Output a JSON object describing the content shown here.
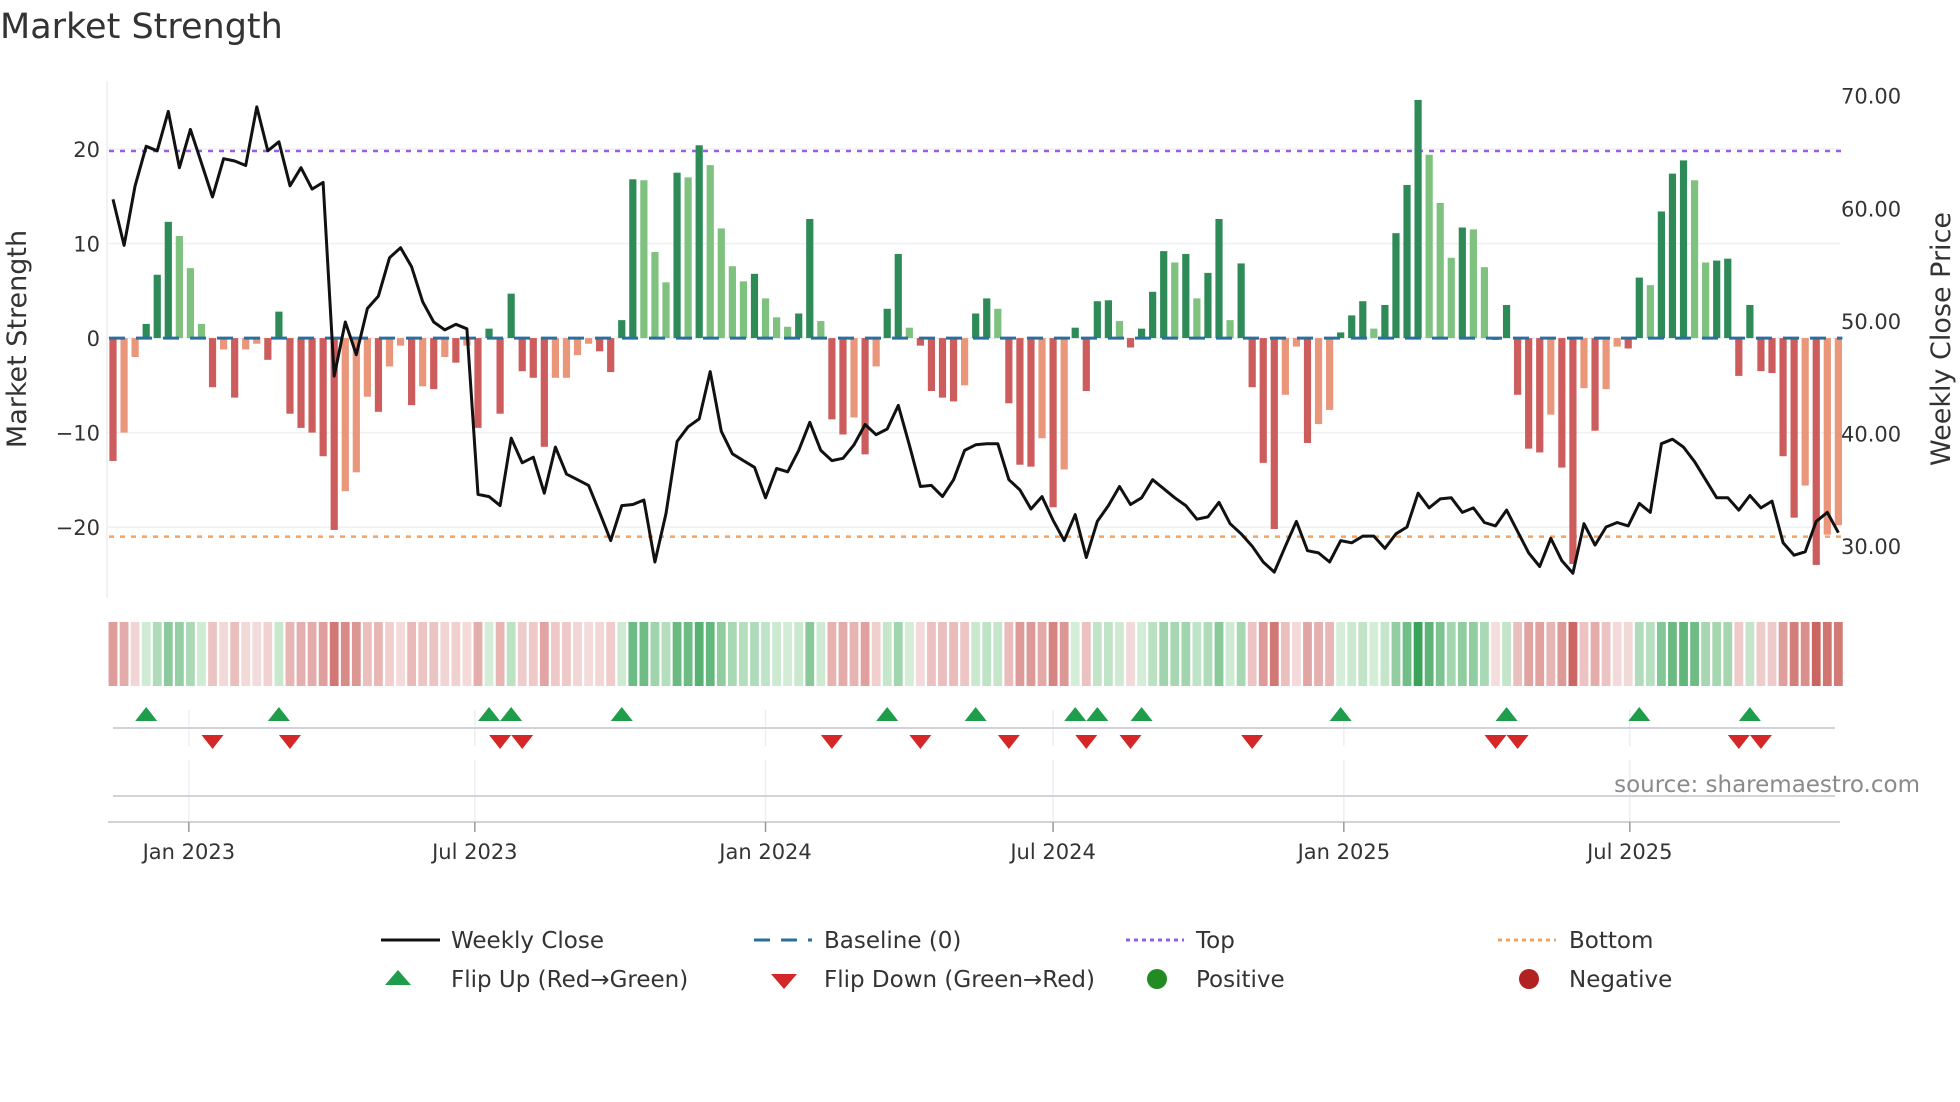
{
  "title": "Market Strength",
  "source": "source: sharemaestro.com",
  "legend": {
    "weekly_close": "Weekly Close",
    "baseline": "Baseline (0)",
    "top": "Top",
    "bottom": "Bottom",
    "flip_up": "Flip Up (Red→Green)",
    "flip_down": "Flip Down (Green→Red)",
    "positive": "Positive",
    "negative": "Negative"
  },
  "colors": {
    "strong_pos": "#2e8b57",
    "weak_pos": "#7fc17f",
    "strong_neg": "#cd5c5c",
    "weak_neg": "#e9967a",
    "close": "#111111",
    "baseline": "#2a6f9e",
    "top": "#9b5de5",
    "bottom": "#f4a460",
    "flip_up": "#1e9e4a",
    "flip_down": "#d62728",
    "positive": "#228b22",
    "negative": "#b22222"
  },
  "chart_data": {
    "type": "bar+line",
    "title": "Market Strength",
    "ylabel": "Market Strength",
    "ylabel_right": "Weekly Close Price",
    "x_start": "2022-11-14",
    "x_step_days": 7,
    "ylim": [
      -27.5,
      27.2
    ],
    "ylim_right": [
      25.4,
      71.3
    ],
    "yticks": [
      {
        "v": 20,
        "label": "20"
      },
      {
        "v": 10,
        "label": "10"
      },
      {
        "v": 0,
        "label": "0"
      },
      {
        "v": -10,
        "label": "−10"
      },
      {
        "v": -20,
        "label": "−20"
      }
    ],
    "yticks_right": [
      {
        "v": 70,
        "label": "70.00"
      },
      {
        "v": 60,
        "label": "60.00"
      },
      {
        "v": 50,
        "label": "50.00"
      },
      {
        "v": 40,
        "label": "40.00"
      },
      {
        "v": 30,
        "label": "30.00"
      }
    ],
    "xticks": [
      {
        "date": "2023-01-01",
        "label": "Jan 2023"
      },
      {
        "date": "2023-07-01",
        "label": "Jul 2023"
      },
      {
        "date": "2024-01-01",
        "label": "Jan 2024"
      },
      {
        "date": "2024-07-01",
        "label": "Jul 2024"
      },
      {
        "date": "2025-01-01",
        "label": "Jan 2025"
      },
      {
        "date": "2025-07-01",
        "label": "Jul 2025"
      }
    ],
    "levels": {
      "top": 19.8,
      "bottom": -21.0,
      "baseline": 0
    },
    "strength": [
      -13,
      -10,
      -2,
      1.5,
      6.7,
      12.3,
      10.8,
      7.4,
      1.5,
      -5.2,
      -1.2,
      -6.3,
      -1.2,
      -0.6,
      -2.3,
      2.8,
      -8,
      -9.5,
      -10,
      -12.5,
      -20.3,
      -16.2,
      -14.2,
      -6.2,
      -7.8,
      -3,
      -0.8,
      -7.1,
      -5.1,
      -5.4,
      -2,
      -2.6,
      -0.8,
      -9.5,
      1,
      -8,
      4.7,
      -3.5,
      -4.2,
      -11.5,
      -4.2,
      -4.2,
      -1.8,
      -0.6,
      -1.4,
      -3.6,
      1.9,
      16.8,
      16.7,
      9.1,
      5.9,
      17.5,
      17,
      20.4,
      18.3,
      11.6,
      7.6,
      6,
      6.8,
      4.2,
      2.2,
      1.2,
      2.6,
      12.6,
      1.8,
      -8.6,
      -10.2,
      -8.4,
      -12.3,
      -3,
      3.1,
      8.9,
      1.1,
      -0.8,
      -5.6,
      -6.3,
      -6.7,
      -5,
      2.6,
      4.2,
      3.1,
      -6.9,
      -13.4,
      -13.6,
      -10.6,
      -17.9,
      -13.9,
      1.1,
      -5.6,
      3.9,
      4.0,
      1.8,
      -1.0,
      1.0,
      4.9,
      9.2,
      8.0,
      8.9,
      4.2,
      6.9,
      12.6,
      1.9,
      7.9,
      -5.2,
      -13.2,
      -20.2,
      -6,
      -0.9,
      -11.1,
      -9.1,
      -7.6,
      0.6,
      2.4,
      3.9,
      1.0,
      3.5,
      11.1,
      16.2,
      25.2,
      19.4,
      14.3,
      8.5,
      11.7,
      11.5,
      7.5,
      -0.2,
      3.5,
      -6,
      -11.7,
      -12.1,
      -8.1,
      -13.7,
      -23.9,
      -5.3,
      -9.8,
      -5.4,
      -0.9,
      -1.1,
      6.4,
      5.6,
      13.4,
      17.4,
      18.8,
      16.7,
      8.0,
      8.2,
      8.4,
      -4,
      3.5,
      -3.5,
      -3.7,
      -12.5,
      -19,
      -15.6,
      -24,
      -20.8,
      -19.8
    ],
    "close": [
      60.8,
      56.7,
      62,
      65.5,
      65.1,
      68.6,
      63.6,
      67,
      64,
      61,
      64.4,
      64.2,
      63.8,
      69,
      65.1,
      65.9,
      62,
      63.6,
      61.7,
      62.3,
      45.1,
      49.9,
      47,
      51.1,
      52.2,
      55.6,
      56.5,
      54.8,
      51.7,
      49.9,
      49.2,
      49.7,
      49.3,
      34.6,
      34.4,
      33.6,
      39.6,
      37.4,
      37.9,
      34.7,
      38.8,
      36.4,
      35.9,
      35.4,
      33,
      30.5,
      33.6,
      33.7,
      34.1,
      28.6,
      32.9,
      39.3,
      40.6,
      41.3,
      45.5,
      40.2,
      38.2,
      37.6,
      37,
      34.3,
      36.9,
      36.6,
      38.5,
      41,
      38.5,
      37.6,
      37.8,
      39,
      40.8,
      39.9,
      40.4,
      42.5,
      39,
      35.3,
      35.4,
      34.4,
      35.9,
      38.5,
      39,
      39.1,
      39.1,
      35.9,
      35,
      33.3,
      34.4,
      32.3,
      30.5,
      32.8,
      29,
      32.2,
      33.6,
      35.3,
      33.7,
      34.3,
      35.9,
      35.1,
      34.3,
      33.6,
      32.4,
      32.6,
      33.9,
      32,
      31.1,
      30,
      28.6,
      27.7,
      30,
      32.2,
      29.6,
      29.4,
      28.6,
      30.5,
      30.3,
      30.9,
      30.9,
      29.8,
      31.1,
      31.7,
      34.7,
      33.4,
      34.2,
      34.3,
      33,
      33.4,
      32.1,
      31.8,
      33.2,
      31.3,
      29.4,
      28.2,
      30.7,
      28.7,
      27.6,
      32,
      30.1,
      31.7,
      32.1,
      31.8,
      33.8,
      33,
      39.1,
      39.5,
      38.8,
      37.5,
      35.9,
      34.3,
      34.3,
      33.2,
      34.5,
      33.4,
      34,
      30.3,
      29.2,
      29.5,
      32.2,
      33,
      31.2
    ]
  }
}
